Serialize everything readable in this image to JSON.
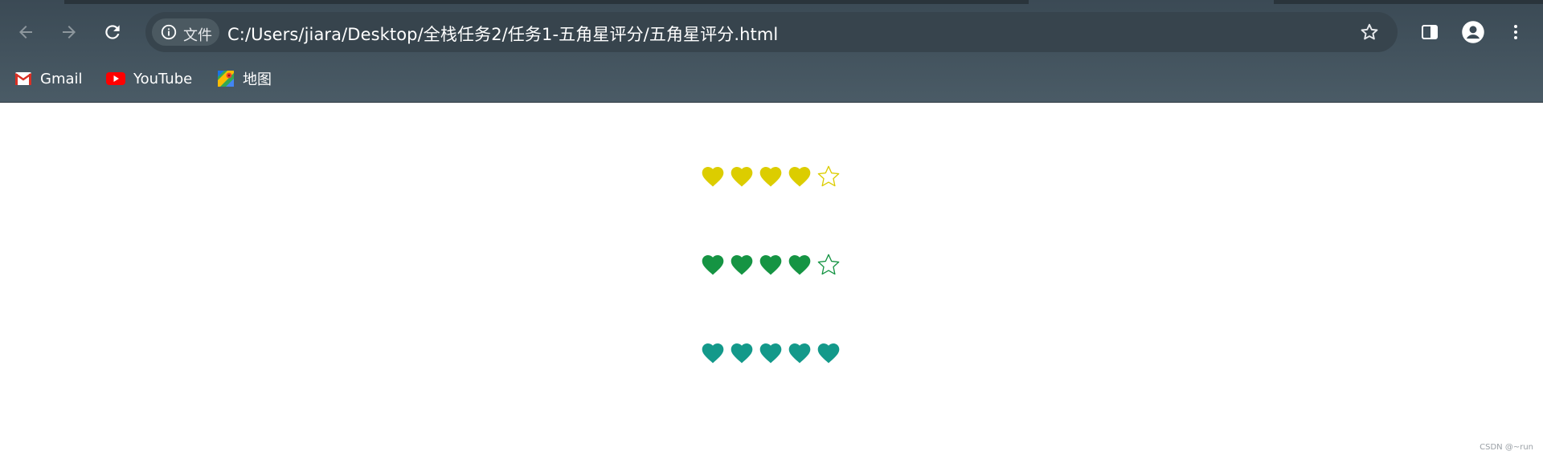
{
  "browser": {
    "address_chip_label": "文件",
    "url": "C:/Users/jiara/Desktop/全栈任务2/任务1-五角星评分/五角星评分.html",
    "bookmarks": [
      {
        "label": "Gmail",
        "icon": "gmail-icon"
      },
      {
        "label": "YouTube",
        "icon": "youtube-icon"
      },
      {
        "label": "地图",
        "icon": "maps-icon"
      }
    ],
    "icons": [
      "back-icon",
      "forward-icon",
      "reload-icon",
      "info-icon",
      "bookmark-star-icon",
      "side-panel-icon",
      "profile-icon",
      "more-menu-icon"
    ]
  },
  "ratings": [
    {
      "value": 4,
      "max": 5,
      "filled_symbol": "heart",
      "empty_symbol": "star-outline",
      "color": "#dccd00"
    },
    {
      "value": 4,
      "max": 5,
      "filled_symbol": "heart",
      "empty_symbol": "star-outline",
      "color": "#159443"
    },
    {
      "value": 5,
      "max": 5,
      "filled_symbol": "heart",
      "empty_symbol": "star-outline",
      "color": "#13998a"
    }
  ],
  "footer": {
    "watermark": "CSDN @~run"
  }
}
